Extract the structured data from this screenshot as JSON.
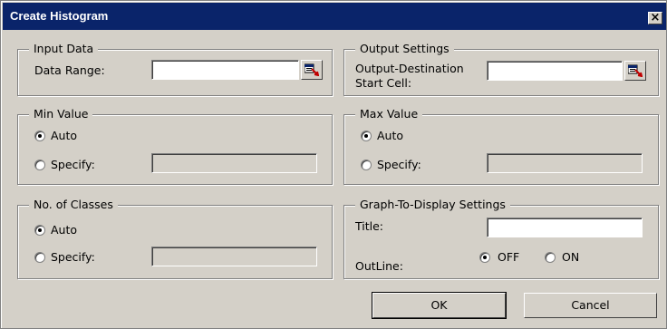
{
  "window": {
    "title": "Create Histogram",
    "close_label": "×"
  },
  "input_data": {
    "legend": "Input Data",
    "data_range_label": "Data Range:",
    "data_range_value": ""
  },
  "output_settings": {
    "legend": "Output Settings",
    "dest_label_line1": "Output-Destination",
    "dest_label_line2": "Start Cell:",
    "dest_value": ""
  },
  "min_value": {
    "legend": "Min Value",
    "auto_label": "Auto",
    "specify_label": "Specify:",
    "selected": "auto",
    "specify_value": ""
  },
  "max_value": {
    "legend": "Max Value",
    "auto_label": "Auto",
    "specify_label": "Specify:",
    "selected": "auto",
    "specify_value": ""
  },
  "classes": {
    "legend": "No. of Classes",
    "auto_label": "Auto",
    "specify_label": "Specify:",
    "selected": "auto",
    "specify_value": ""
  },
  "graph_settings": {
    "legend": "Graph-To-Display Settings",
    "title_label": "Title:",
    "title_value": "",
    "outline_label": "OutLine:",
    "off_label": "OFF",
    "on_label": "ON",
    "outline_selected": "off"
  },
  "buttons": {
    "ok_label": "OK",
    "cancel_label": "Cancel"
  },
  "icons": {
    "range_picker": "range-picker-icon"
  },
  "colors": {
    "titlebar": "#0a246a",
    "face": "#d4d0c8"
  }
}
